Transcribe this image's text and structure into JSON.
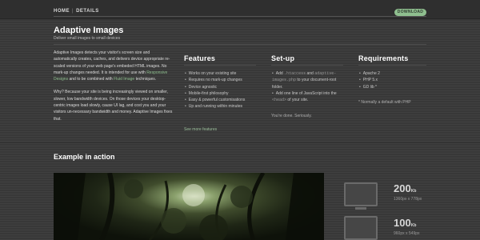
{
  "nav": {
    "home": "HOME",
    "separator": "|",
    "details": "DETAILS",
    "download": "DOWNLOAD"
  },
  "header": {
    "title": "Adaptive Images",
    "subtitle": "Deliver small images to small devices"
  },
  "intro": {
    "p1_a": "Adaptive Images detects your visitor's screen size and automatically creates, caches, and delivers device appropriate re-scaled versions of your web page's embeded HTML images. No mark-up changes needed. It is intended for use with ",
    "p1_link1": "Responsive Designs",
    "p1_b": " and to be combined with ",
    "p1_link2": "Fluid Image",
    "p1_c": " techniques.",
    "p2": "Why? Because your site is being increasingly viewed on smaller, slower, low bandwidth devices. On those devices your desktop-centric images load slowly, cause UI lag, and cost you and your visitors un-necessary bandwidth and money. Adaptive Images fixes that."
  },
  "features": {
    "title": "Features",
    "items": [
      "Works on your existing site",
      "Requires no mark-up changes",
      "Device agnostic",
      "Mobile-first philosophy",
      "Easy & powerful customisations",
      "Up and running within minutes"
    ],
    "see_more": "See more features"
  },
  "setup": {
    "title": "Set-up",
    "step1_a": "Add ",
    "step1_code1": ".htaccess",
    "step1_b": " and ",
    "step1_code2": "adaptive-images.php",
    "step1_c": " to your document-root folder.",
    "step2_a": "Add one line of JavaScript into the ",
    "step2_code": "<head>",
    "step2_b": " of your site.",
    "done": "You're done. Seriously."
  },
  "requirements": {
    "title": "Requirements",
    "items": [
      "Apache 2",
      "PHP 5.x",
      "GD lib *"
    ],
    "note": "* Normally a default with PHP"
  },
  "example": {
    "title": "Example in action",
    "sizes": [
      {
        "value": "200",
        "unit": "Kb",
        "resolution": "1360px x 778px"
      },
      {
        "value": "100",
        "unit": "Kb",
        "resolution": "960px x 549px"
      }
    ]
  }
}
